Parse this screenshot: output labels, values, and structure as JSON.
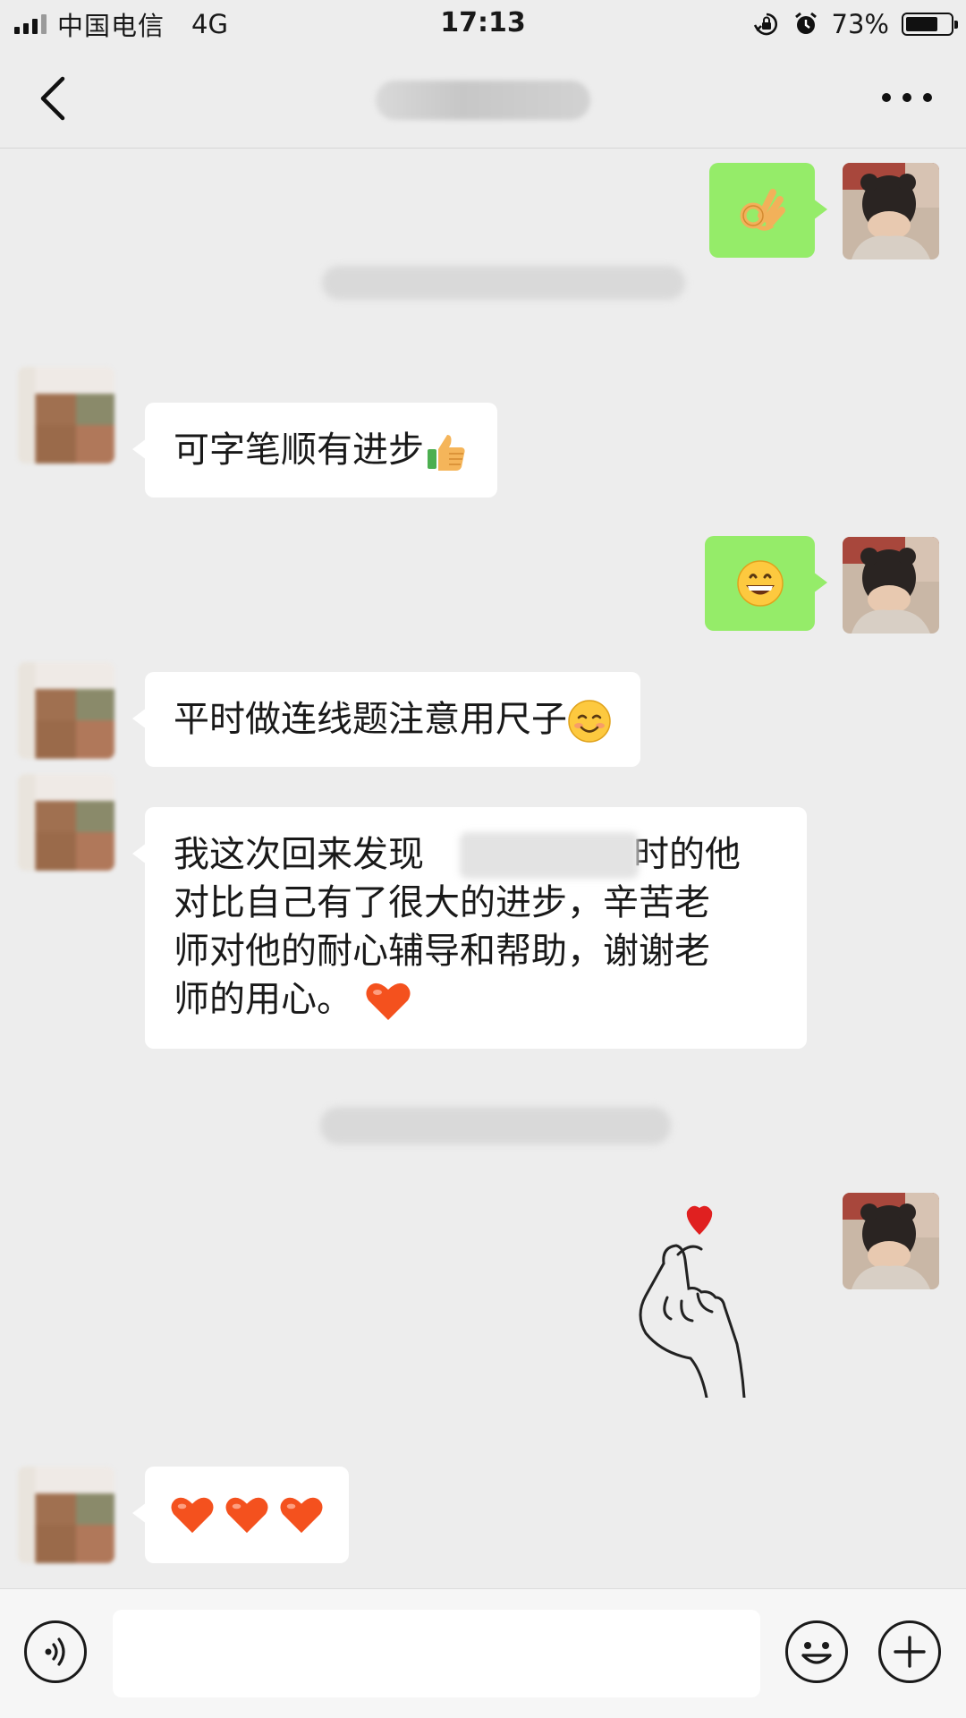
{
  "status_bar": {
    "carrier": "中国电信",
    "network": "4G",
    "time": "17:13",
    "battery": "73%",
    "icons": [
      "rotation-lock-icon",
      "alarm-icon",
      "battery-icon",
      "signal-icon"
    ]
  },
  "nav": {
    "title": "",
    "back_icon": "chevron-left-icon",
    "more_icon": "more-dots-icon"
  },
  "messages": [
    {
      "sender": "self",
      "type": "emoji",
      "content": "ok-hand-emoji"
    },
    {
      "sender": "other",
      "type": "text",
      "text": "可字笔顺有进步",
      "emoji": "thumbs-up-emoji"
    },
    {
      "sender": "self",
      "type": "emoji",
      "content": "grinning-face-emoji"
    },
    {
      "sender": "other",
      "type": "text",
      "text": "平时做连线题注意用尺子",
      "emoji": "smiling-face-emoji"
    },
    {
      "sender": "other",
      "type": "text",
      "lines": [
        "我这次回来发现",
        "对比自己有了很大的进步，辛苦老",
        "师对他的耐心辅导和帮助，谢谢老",
        "师的用心。"
      ],
      "line1_tail": "时的他",
      "emoji": "orange-heart-emoji"
    },
    {
      "sender": "self",
      "type": "sticker",
      "content": "finger-heart-sticker"
    },
    {
      "sender": "other",
      "type": "emoji",
      "content": "three-orange-hearts-emoji"
    }
  ],
  "input_bar": {
    "placeholder": "",
    "icons": [
      "voice-icon",
      "emoji-icon",
      "plus-icon"
    ]
  },
  "colors": {
    "background": "#ededed",
    "self_bubble": "#95ec69",
    "other_bubble": "#ffffff",
    "heart": "#f4511e"
  }
}
